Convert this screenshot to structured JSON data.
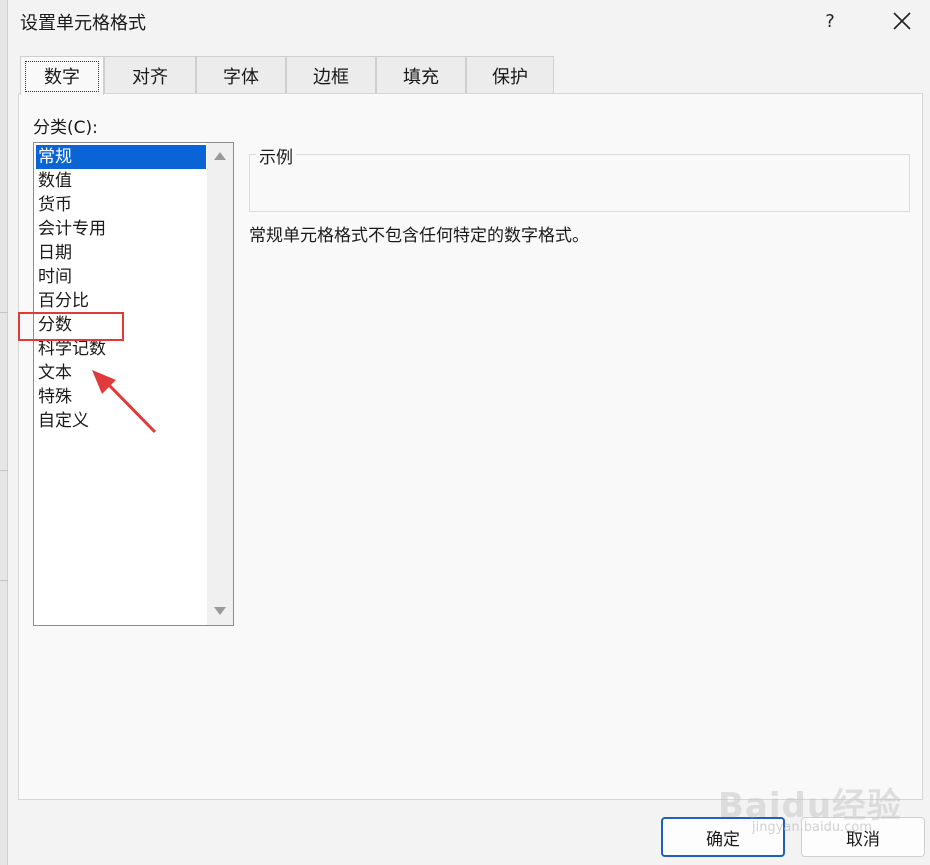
{
  "window": {
    "title": "设置单元格格式",
    "help_label": "?"
  },
  "tabs": [
    {
      "label": "数字",
      "active": true
    },
    {
      "label": "对齐",
      "active": false
    },
    {
      "label": "字体",
      "active": false
    },
    {
      "label": "边框",
      "active": false
    },
    {
      "label": "填充",
      "active": false
    },
    {
      "label": "保护",
      "active": false
    }
  ],
  "category": {
    "label": "分类(C):",
    "items": [
      "常规",
      "数值",
      "货币",
      "会计专用",
      "日期",
      "时间",
      "百分比",
      "分数",
      "科学记数",
      "文本",
      "特殊",
      "自定义"
    ],
    "selected": "常规"
  },
  "sample": {
    "label": "示例",
    "value": ""
  },
  "description": "常规单元格格式不包含任何特定的数字格式。",
  "buttons": {
    "ok_label": "确定",
    "cancel_label": "取消"
  },
  "annotation": {
    "highlighted_item": "分数",
    "color": "#e03a3a"
  },
  "watermark": {
    "text": "Baidu经验",
    "sub": "jingyan.baidu.com"
  },
  "colors": {
    "selection": "#0a64d6",
    "dialog_bg": "#f3f3f3",
    "panel_bg": "#f9f9f9"
  }
}
